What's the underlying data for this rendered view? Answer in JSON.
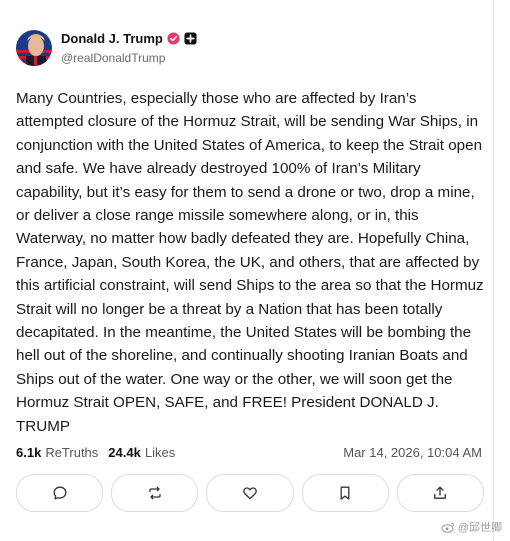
{
  "post": {
    "author_name": "Donald J. Trump",
    "handle": "@realDonaldTrump",
    "text": "Many Countries, especially those who are affected by Iran’s attempted closure of the Hormuz Strait, will be sending War Ships, in conjunction with the United States of America, to keep the Strait open and safe. We have already destroyed 100% of Iran’s Military capability, but it’s easy for them to send a drone or two, drop a mine, or deliver a close range missile somewhere along, or in, this Waterway, no matter how badly defeated they are. Hopefully China, France, Japan, South Korea, the UK, and others, that are affected by this artificial constraint, will send Ships to the area so that the Hormuz Strait will no longer be a threat by a Nation that has been totally decapitated. In the meantime, the United States will be bombing the hell out of the shoreline, and continually shooting Iranian Boats and Ships out of the water. One way or the other, we will soon get the Hormuz Strait OPEN, SAFE, and FREE! President DONALD J. TRUMP",
    "retruths_count": "6.1k",
    "retruths_label": "ReTruths",
    "likes_count": "24.4k",
    "likes_label": "Likes",
    "timestamp": "Mar 14, 2026, 10:04 AM"
  },
  "actions": [
    {
      "icon": "reply-icon"
    },
    {
      "icon": "retruth-icon"
    },
    {
      "icon": "heart-icon"
    },
    {
      "icon": "bookmark-icon"
    },
    {
      "icon": "share-icon"
    }
  ],
  "watermark": {
    "text": "@邱世卿"
  },
  "colors": {
    "verified_badge": "#e8396b",
    "border": "#dcdcdc",
    "muted_text": "#6b6b6b"
  }
}
